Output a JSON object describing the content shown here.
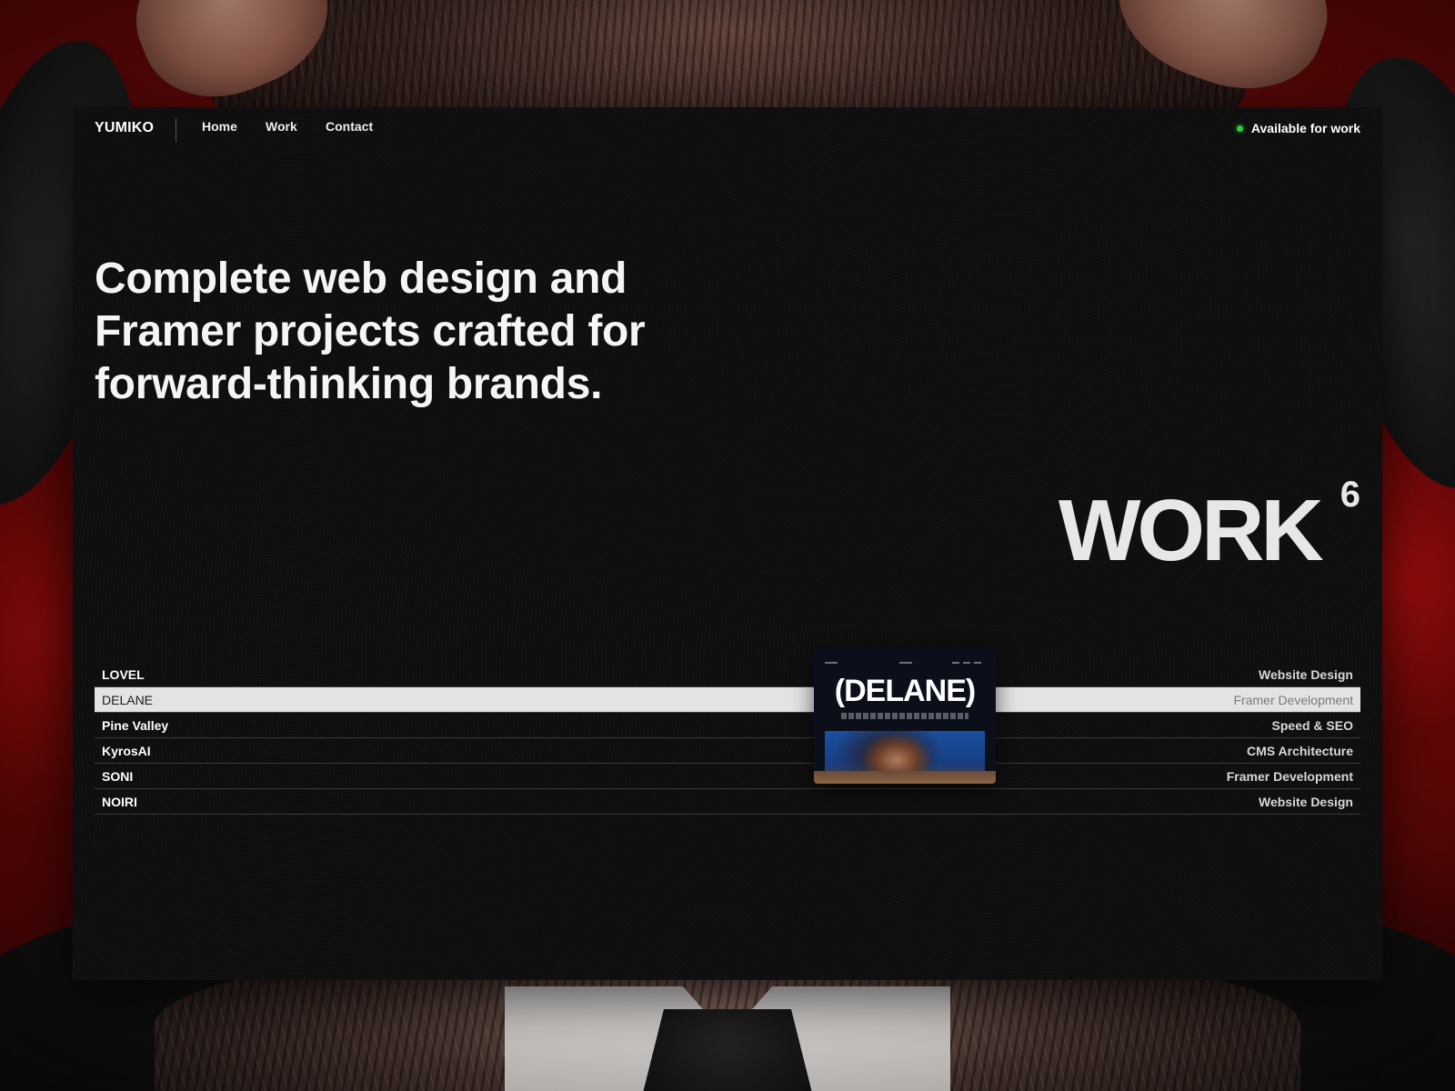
{
  "brand": {
    "logo": "YUMIKO"
  },
  "nav": {
    "items": [
      {
        "label": "Home"
      },
      {
        "label": "Work"
      },
      {
        "label": "Contact"
      }
    ]
  },
  "status": {
    "label": "Available for work",
    "color": "#2ecc40"
  },
  "hero": {
    "heading": "Complete web design and Framer projects crafted for forward-thinking brands."
  },
  "work": {
    "title": "WORK",
    "count": "6"
  },
  "projects": [
    {
      "name": "LOVEL",
      "service": "Website Design"
    },
    {
      "name": "DELANE",
      "service": "Framer Development",
      "active": true
    },
    {
      "name": "Pine Valley",
      "service": "Speed & SEO"
    },
    {
      "name": "KyrosAI",
      "service": "CMS Architecture"
    },
    {
      "name": "SONI",
      "service": "Framer Development"
    },
    {
      "name": "NOIRI",
      "service": "Website Design"
    }
  ],
  "preview": {
    "title": "(DELANE)"
  }
}
